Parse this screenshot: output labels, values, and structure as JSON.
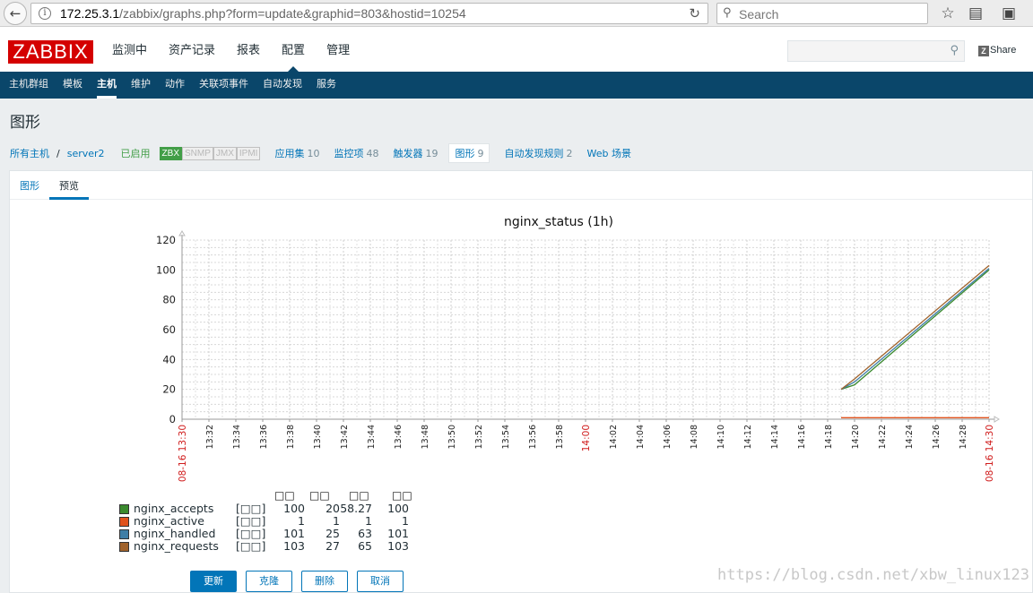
{
  "browser": {
    "url_host": "172.25.3.1",
    "url_path": "/zabbix/graphs.php?form=update&graphid=803&hostid=10254",
    "search_placeholder": "Search"
  },
  "header": {
    "logo": "ZABBIX",
    "menu": [
      "监测中",
      "资产记录",
      "报表",
      "配置",
      "管理"
    ],
    "share": "Share"
  },
  "subnav": [
    "主机群组",
    "模板",
    "主机",
    "维护",
    "动作",
    "关联项事件",
    "自动发现",
    "服务"
  ],
  "page": {
    "title": "图形",
    "breadcrumb_all": "所有主机",
    "breadcrumb_sep": "/",
    "host": "server2",
    "status": "已启用",
    "badges": [
      "ZBX",
      "SNMP",
      "JMX",
      "IPMI"
    ],
    "items": [
      {
        "label": "应用集",
        "count": "10"
      },
      {
        "label": "监控项",
        "count": "48"
      },
      {
        "label": "触发器",
        "count": "19"
      },
      {
        "label": "图形",
        "count": "9"
      },
      {
        "label": "自动发现规则",
        "count": "2"
      },
      {
        "label": "Web 场景",
        "count": ""
      }
    ],
    "tabs": [
      "图形",
      "预览"
    ]
  },
  "chart_data": {
    "type": "line",
    "title": "nginx_status (1h)",
    "xlabel": "",
    "ylabel": "",
    "ylim": [
      0,
      120
    ],
    "y_ticks": [
      "0",
      "20",
      "40",
      "60",
      "80",
      "100",
      "120"
    ],
    "x_ticks": [
      "08-16 13:30",
      "13:32",
      "13:34",
      "13:36",
      "13:38",
      "13:40",
      "13:42",
      "13:44",
      "13:46",
      "13:48",
      "13:50",
      "13:52",
      "13:54",
      "13:56",
      "13:58",
      "14:00",
      "14:02",
      "14:04",
      "14:06",
      "14:08",
      "14:10",
      "14:12",
      "14:14",
      "14:16",
      "14:18",
      "14:20",
      "14:22",
      "14:24",
      "14:26",
      "14:28",
      "08-16 14:30"
    ],
    "x_tick_red": [
      "08-16 13:30",
      "14:00",
      "08-16 14:30"
    ],
    "grid": true,
    "series": [
      {
        "name": "nginx_accepts",
        "color": "#3b8a2e",
        "x": [
          "14:19",
          "14:20",
          "14:30"
        ],
        "values": [
          20,
          23,
          100
        ]
      },
      {
        "name": "nginx_active",
        "color": "#e0521c",
        "x": [
          "14:19",
          "14:30"
        ],
        "values": [
          1,
          1
        ]
      },
      {
        "name": "nginx_handled",
        "color": "#3f7ea6",
        "x": [
          "14:19",
          "14:20",
          "14:30"
        ],
        "values": [
          20,
          25,
          101
        ]
      },
      {
        "name": "nginx_requests",
        "color": "#a0622b",
        "x": [
          "14:19",
          "14:20",
          "14:30"
        ],
        "values": [
          20,
          27,
          103
        ]
      }
    ],
    "legend": {
      "headers": [
        "□□",
        "□□",
        "□□",
        "□□"
      ],
      "fn": "[□□]",
      "rows": [
        {
          "name": "nginx_accepts",
          "color": "#3b8a2e",
          "v": [
            "100",
            "20",
            "58.27",
            "100"
          ]
        },
        {
          "name": "nginx_active",
          "color": "#e0521c",
          "v": [
            "1",
            "1",
            "1",
            "1"
          ]
        },
        {
          "name": "nginx_handled",
          "color": "#3f7ea6",
          "v": [
            "101",
            "25",
            "63",
            "101"
          ]
        },
        {
          "name": "nginx_requests",
          "color": "#a0622b",
          "v": [
            "103",
            "27",
            "65",
            "103"
          ]
        }
      ]
    }
  },
  "buttons": [
    "更新",
    "克隆",
    "删除",
    "取消"
  ],
  "watermark": "https://blog.csdn.net/xbw_linux123"
}
